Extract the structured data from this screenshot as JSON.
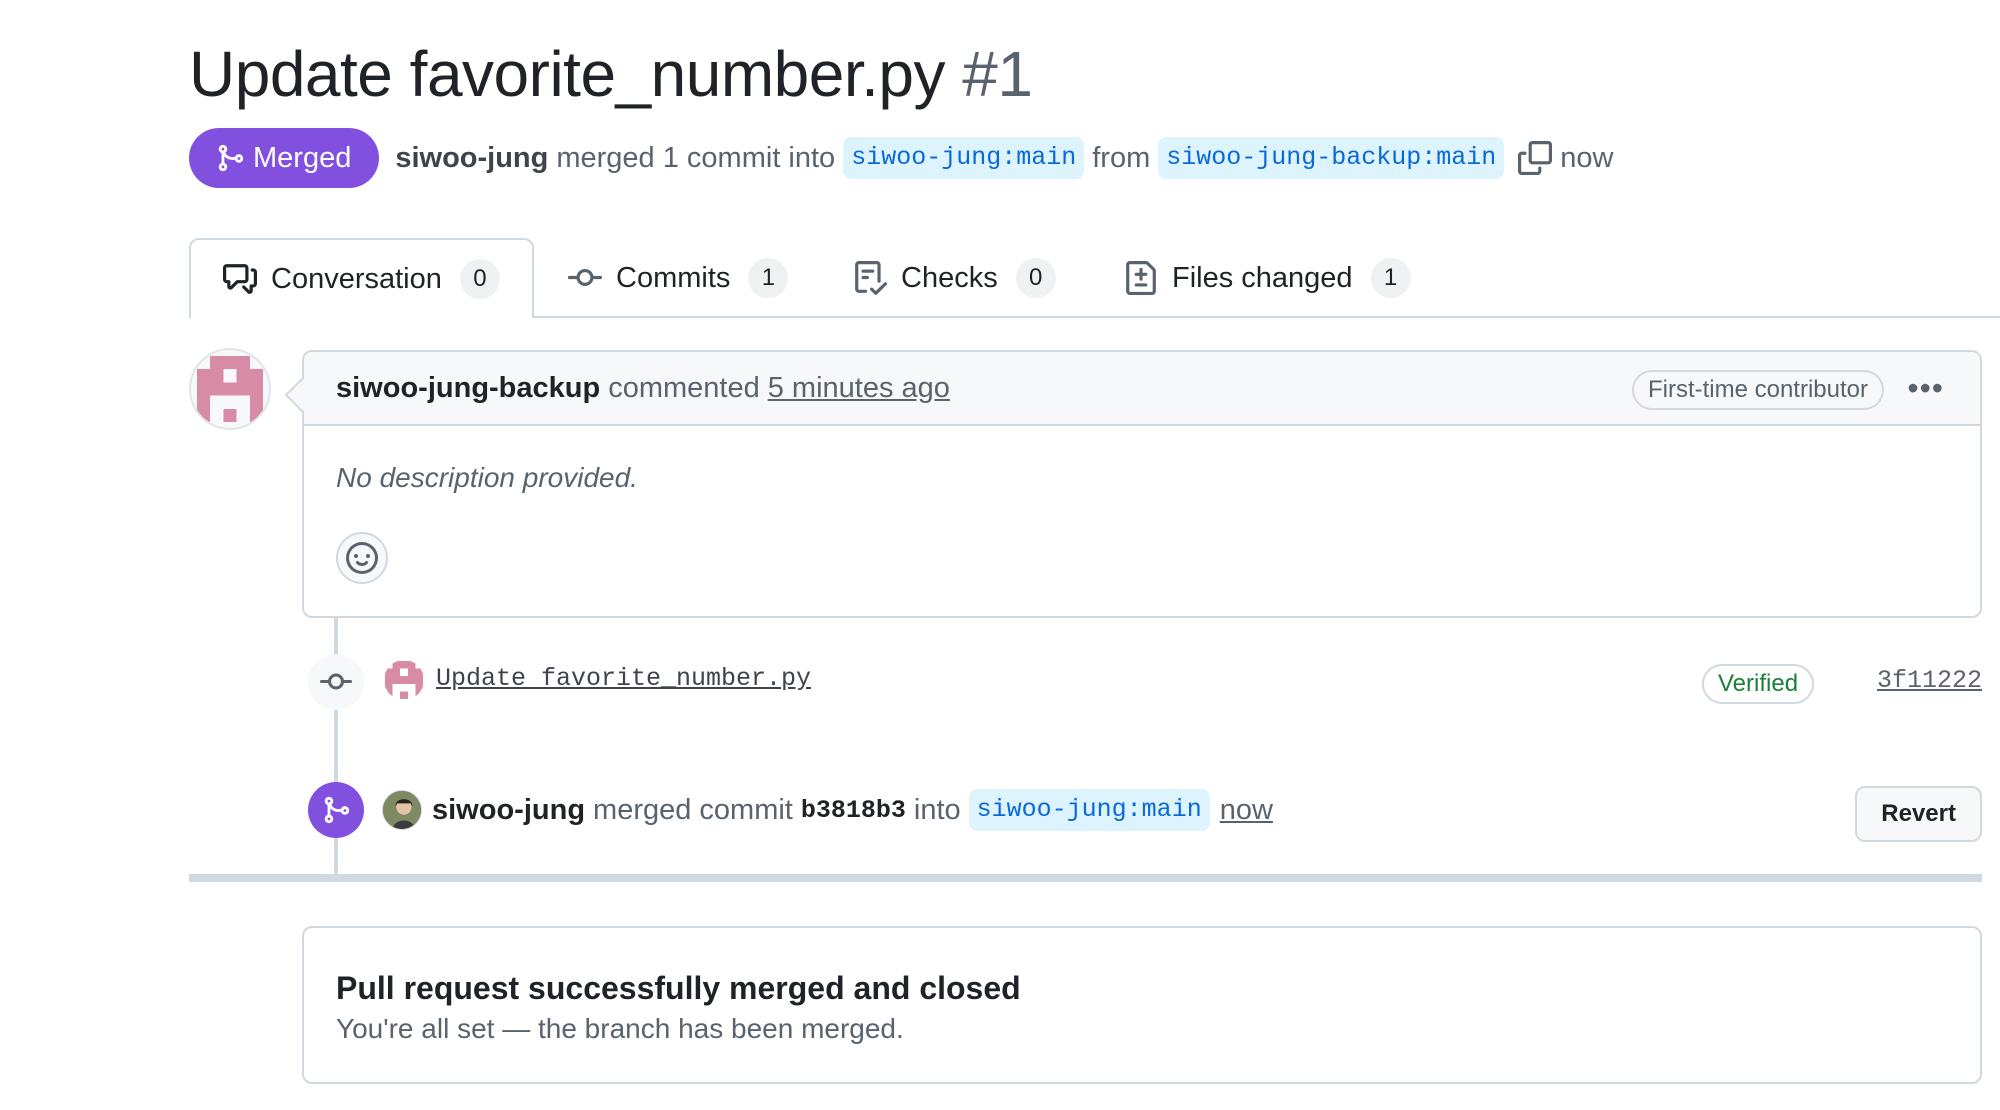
{
  "title": {
    "text": "Update favorite_number.py",
    "number": "#1"
  },
  "meta": {
    "state": "Merged",
    "author": "siwoo-jung",
    "merged_text": "merged 1 commit into",
    "base_branch": "siwoo-jung:main",
    "from_text": "from",
    "head_branch": "siwoo-jung-backup:main",
    "time": "now"
  },
  "tabs": [
    {
      "label": "Conversation",
      "count": "0",
      "icon": "comment-discussion-icon"
    },
    {
      "label": "Commits",
      "count": "1",
      "icon": "git-commit-icon"
    },
    {
      "label": "Checks",
      "count": "0",
      "icon": "checklist-icon"
    },
    {
      "label": "Files changed",
      "count": "1",
      "icon": "file-diff-icon"
    }
  ],
  "comment": {
    "author": "siwoo-jung-backup",
    "action": "commented",
    "time": "5 minutes ago",
    "badge": "First-time contributor",
    "menu": "•••",
    "body": "No description provided."
  },
  "commit": {
    "message": "Update favorite_number.py",
    "verified": "Verified",
    "sha": "3f11222"
  },
  "merge_event": {
    "author": "siwoo-jung",
    "text1": "merged commit",
    "sha": "b3818b3",
    "text2": "into",
    "branch": "siwoo-jung:main",
    "time": "now",
    "revert_label": "Revert"
  },
  "closed": {
    "title": "Pull request successfully merged and closed",
    "subtitle": "You're all set — the branch has been merged."
  },
  "colors": {
    "merged_purple": "#8250df",
    "branch_bg": "#ddf4ff",
    "branch_fg": "#0969da",
    "verified_green": "#1a7f37",
    "avatar_pink": "#d88ba4"
  }
}
